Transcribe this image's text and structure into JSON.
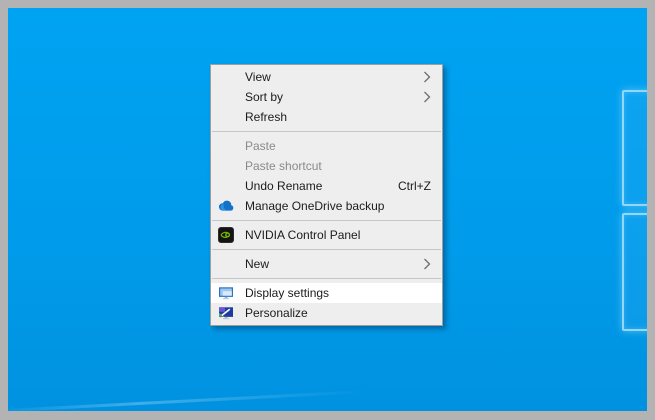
{
  "colors": {
    "desktop_blue": "#009bea",
    "frame_gray": "#b3b3b3",
    "menu_background": "#eeeeee",
    "menu_border": "#9e9e9e",
    "highlight": "#ffffff",
    "disabled_text": "#8a8a8a",
    "nvidia_green": "#76b900",
    "onedrive_blue": "#1172c8"
  },
  "context_menu": {
    "items": [
      {
        "label": "View",
        "submenu": true
      },
      {
        "label": "Sort by",
        "submenu": true
      },
      {
        "label": "Refresh"
      },
      {
        "label": "Paste",
        "disabled": true
      },
      {
        "label": "Paste shortcut",
        "disabled": true
      },
      {
        "label": "Undo Rename",
        "shortcut": "Ctrl+Z"
      },
      {
        "label": "Manage OneDrive backup",
        "icon": "onedrive-icon"
      },
      {
        "label": "NVIDIA Control Panel",
        "icon": "nvidia-icon"
      },
      {
        "label": "New",
        "submenu": true
      },
      {
        "label": "Display settings",
        "icon": "display-settings-icon",
        "highlighted": true
      },
      {
        "label": "Personalize",
        "icon": "personalize-icon"
      }
    ]
  }
}
